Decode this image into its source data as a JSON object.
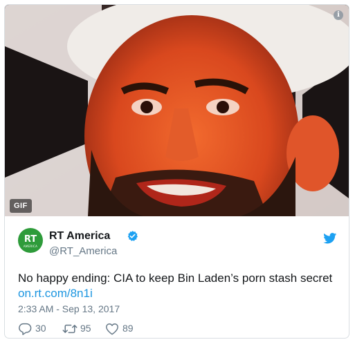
{
  "media": {
    "badge": "GIF",
    "info_icon": "info-icon"
  },
  "tweet": {
    "author_name": "RT America",
    "handle": "@RT_America",
    "avatar": {
      "logo_text": "RT",
      "logo_subtext": "AMERICA",
      "color": "#2e9b3a"
    },
    "verified": true,
    "text": "No happy ending: CIA to keep Bin Laden’s porn stash secret",
    "link": "on.rt.com/8n1i",
    "timestamp": "2:33 AM - Sep 13, 2017",
    "actions": {
      "replies": "30",
      "retweets": "95",
      "likes": "89"
    }
  },
  "colors": {
    "link": "#1b95e0",
    "twitter_blue": "#1da1f2",
    "muted": "#657786"
  }
}
